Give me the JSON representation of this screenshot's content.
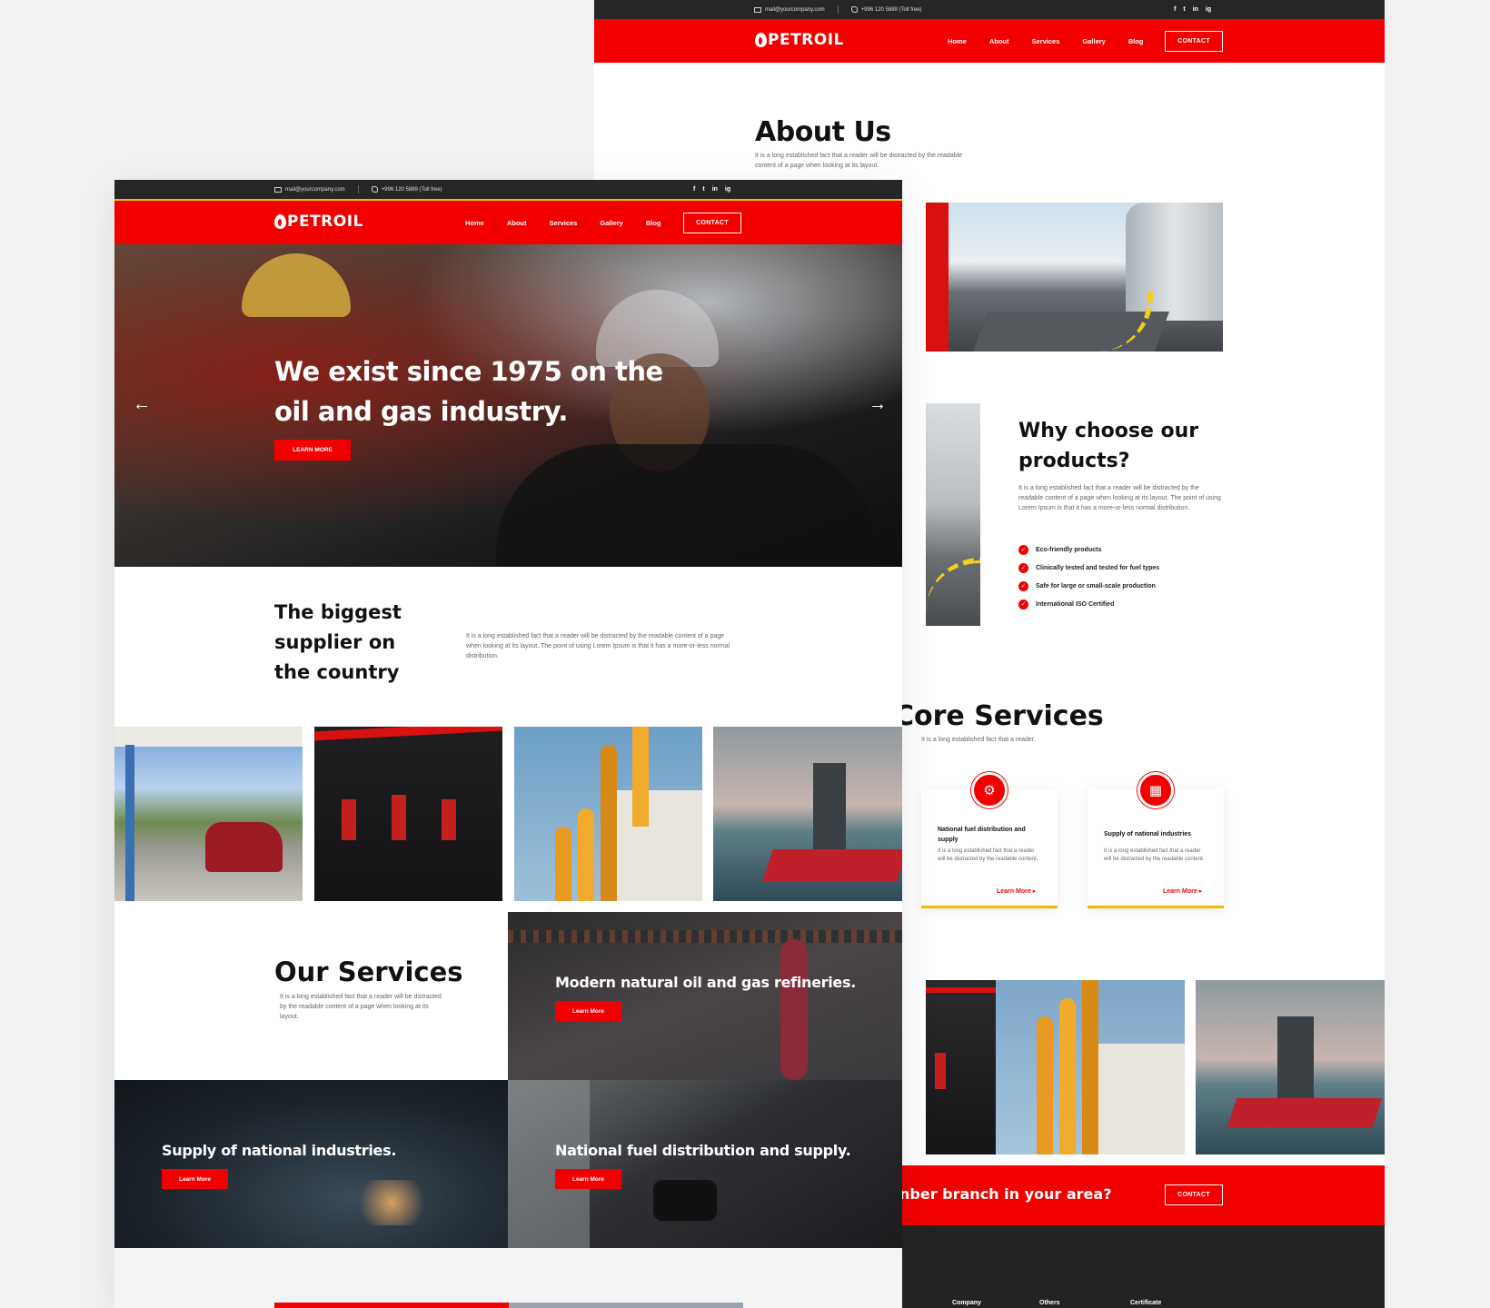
{
  "brand": {
    "logo_text": "PETROIL",
    "red": "#f20000",
    "dark": "#262626",
    "accent_yellow": "#f6b800"
  },
  "topbar": {
    "email": "mail@yourcompany.com",
    "phone": "+996 120 5889 (Toll free)",
    "social": [
      "f",
      "t",
      "in",
      "ig"
    ]
  },
  "nav": {
    "items": [
      "Home",
      "About",
      "Services",
      "Gallery",
      "Blog"
    ],
    "contact": "CONTACT"
  },
  "about_page": {
    "title": "About Us",
    "intro": "It is a long established fact that a reader will be distracted by the readable content of a page when looking at its layout.",
    "why": {
      "title_line1": "Why choose our",
      "title_line2": "products?",
      "text": "It is a long established fact that a reader will be distracted by the readable content of a page when looking at its layout. The point of using Lorem Ipsum is that it has a more-or-less normal distribution.",
      "features": [
        "Eco-friendly products",
        "Clinically tested and tested for fuel types",
        "Safe for large or small-scale production",
        "International ISO Certified"
      ]
    },
    "core": {
      "title": "Core Services",
      "subtitle": "It is a long established fact that a reader.",
      "cards": [
        {
          "title": "National fuel distribution and supply",
          "text": "It is a long established fact that a reader will be distracted by the readable content.",
          "link": "Learn More"
        },
        {
          "title": "Supply of national industries",
          "text": "It is a long established fact that a reader will be distracted by the readable content.",
          "link": "Learn More"
        }
      ]
    },
    "cta": {
      "text": "nber branch in your area?",
      "button": "CONTACT"
    },
    "footer": {
      "columns": [
        "Company",
        "Others",
        "Certificate"
      ]
    }
  },
  "home_page": {
    "hero": {
      "title": "We exist since 1975 on the oil and gas industry.",
      "button": "LEARN MORE",
      "prev": "←",
      "next": "→"
    },
    "intro": {
      "title": "The biggest supplier on the country",
      "text": "It is a long established fact that a reader will be distracted by the readable content of a page when looking at its layout. The point of using Lorem Ipsum is that it has a more-or-less normal distribution."
    },
    "services": {
      "title": "Our Services",
      "text": "It is a long established fact that a reader will be distracted by the readable content of a page when looking at its layout.",
      "tiles": [
        {
          "label": "Modern natural oil and gas refineries.",
          "button": "Learn More"
        },
        {
          "label": "Supply of national industries.",
          "button": "Learn More"
        },
        {
          "label": "National fuel distribution and supply.",
          "button": "Learn More"
        }
      ]
    }
  }
}
